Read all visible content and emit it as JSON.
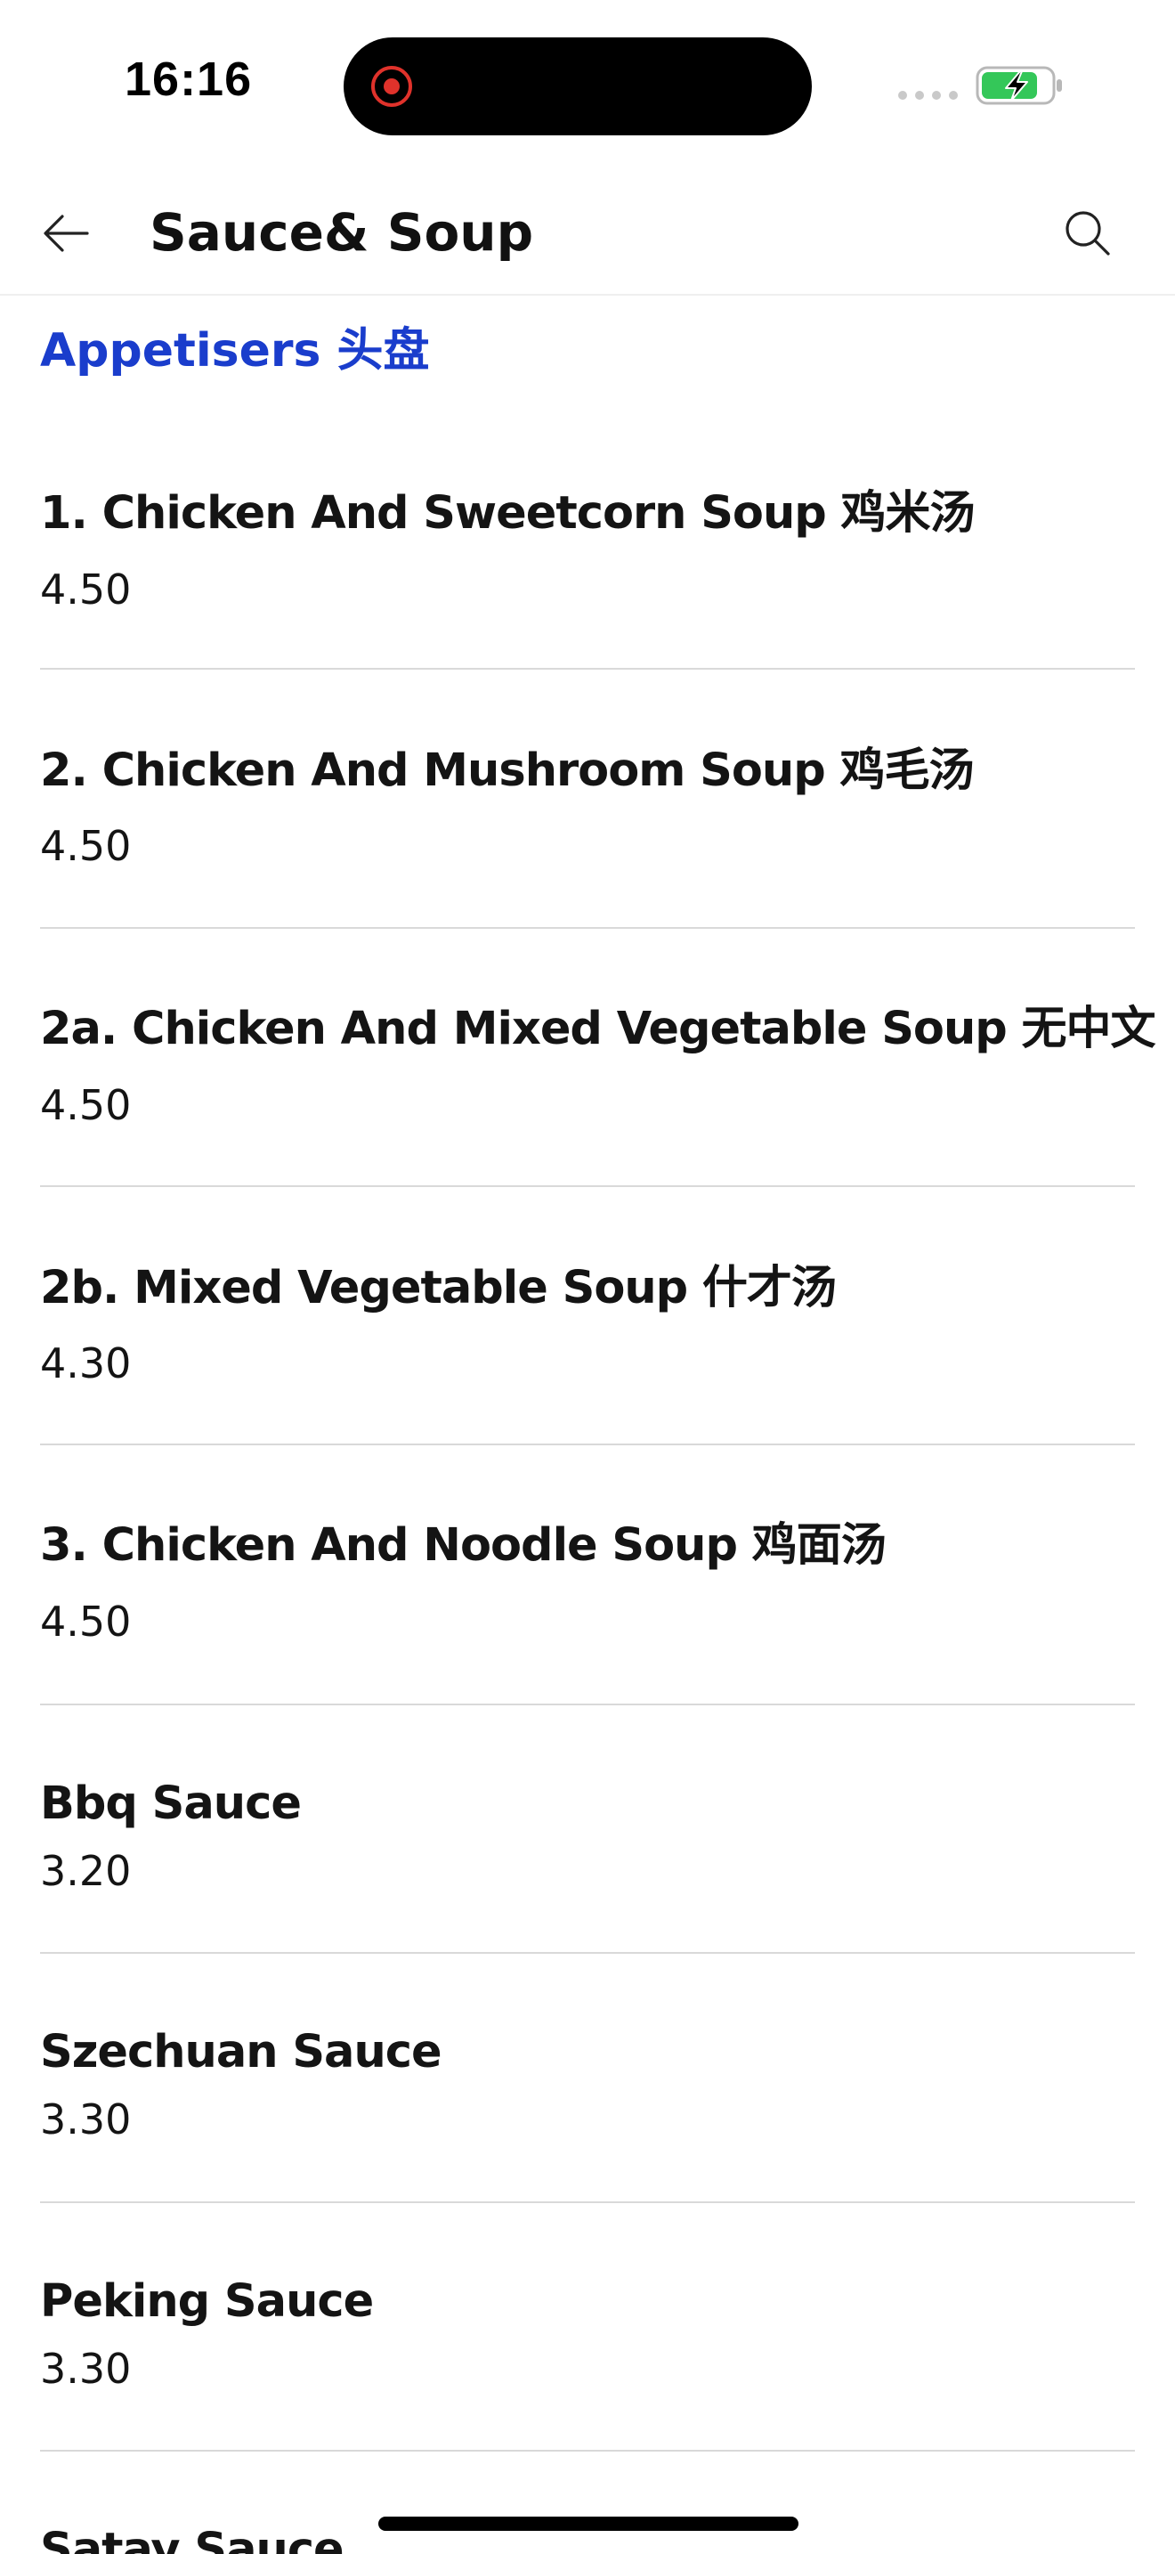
{
  "status_bar": {
    "time": "16:16",
    "recording_color": "#e0322b",
    "battery_color": "#34c759"
  },
  "header": {
    "title": "Sauce& Soup",
    "back_icon": "arrow-left-icon",
    "search_icon": "search-icon"
  },
  "section": {
    "title": "Appetisers 头盘",
    "accent_color": "#1a3dcc"
  },
  "items": [
    {
      "name": "1. Chicken And Sweetcorn Soup 鸡米汤",
      "price": "4.50"
    },
    {
      "name": "2. Chicken And Mushroom Soup 鸡毛汤",
      "price": "4.50"
    },
    {
      "name": "2a. Chicken And Mixed Vegetable Soup 无中文",
      "price": "4.50"
    },
    {
      "name": "2b. Mixed Vegetable Soup 什才汤",
      "price": "4.30"
    },
    {
      "name": "3. Chicken And Noodle Soup 鸡面汤",
      "price": "4.50"
    },
    {
      "name": "Bbq Sauce",
      "price": "3.20"
    },
    {
      "name": "Szechuan Sauce",
      "price": "3.30"
    },
    {
      "name": "Peking Sauce",
      "price": "3.30"
    },
    {
      "name": "Satay Sauce",
      "price": ""
    }
  ]
}
